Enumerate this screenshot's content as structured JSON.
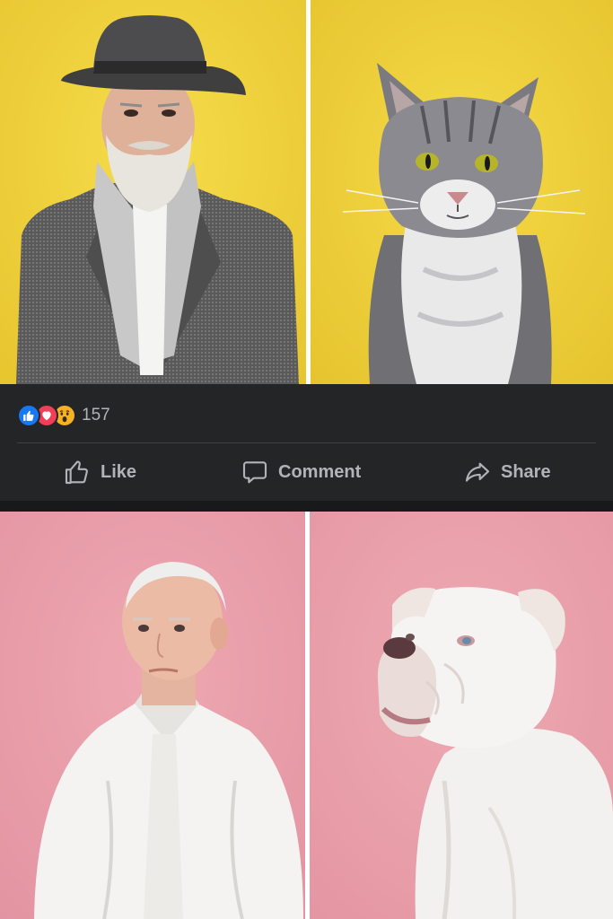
{
  "post": {
    "reactions": {
      "icons": [
        "like-icon",
        "love-icon",
        "wow-icon"
      ],
      "count": "157"
    },
    "actions": {
      "like_label": "Like",
      "comment_label": "Comment",
      "share_label": "Share"
    }
  },
  "colors": {
    "bar_bg": "#242526",
    "text_muted": "#b0b3b8",
    "like_blue": "#1877f2",
    "love_red": "#f33e58",
    "wow_yellow": "#f7b125",
    "yellow_bg": "#f0d23c",
    "pink_bg": "#eaa0ac"
  }
}
